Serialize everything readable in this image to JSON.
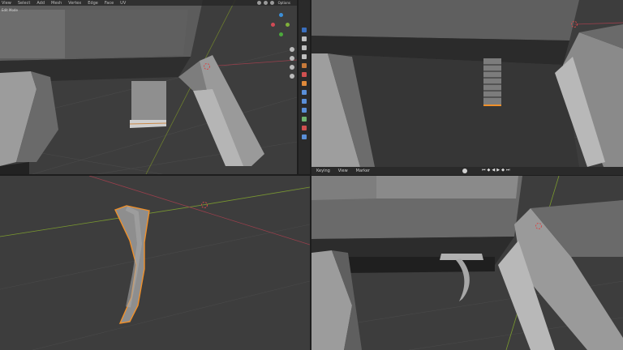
{
  "viewport_top_left": {
    "menu": [
      "View",
      "Select",
      "Add",
      "Mesh",
      "Vertex",
      "Edge",
      "Face",
      "UV"
    ],
    "mode_label": "Edit Mode",
    "options_label": "Options",
    "gizmo_icons": [
      "axis-x-icon",
      "axis-y-icon",
      "axis-z-icon",
      "zoom-icon",
      "hand-icon",
      "camera-icon",
      "grid-icon"
    ]
  },
  "properties_toolbar": {
    "icons": [
      "tool-icon",
      "render-icon",
      "output-icon",
      "view-layer-icon",
      "scene-icon",
      "world-icon",
      "object-icon",
      "modifier-icon",
      "particles-icon",
      "physics-icon",
      "constraints-icon",
      "data-icon",
      "material-icon"
    ]
  },
  "timeline": {
    "menu": [
      "Keying",
      "View",
      "Marker"
    ],
    "controls": [
      "jump-start-icon",
      "prev-keyframe-icon",
      "play-reverse-icon",
      "play-icon",
      "next-keyframe-icon",
      "jump-end-icon"
    ]
  },
  "colors": {
    "viewport_bg": "#3d3d3d",
    "selection_orange": "#f0902a",
    "axis_red": "#a8414f",
    "axis_green": "#7a9a2e",
    "mesh_light": "#8f8f8f",
    "mesh_dark": "#5a5a5a"
  }
}
